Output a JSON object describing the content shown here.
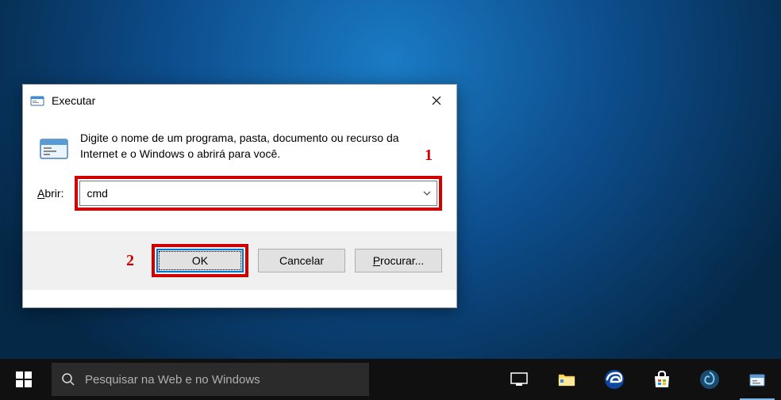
{
  "dialog": {
    "title": "Executar",
    "description": "Digite o nome de um programa, pasta, documento ou recurso da Internet e o Windows o abrirá para você.",
    "open_label_prefix": "A",
    "open_label_suffix": "brir:",
    "open_value": "cmd",
    "buttons": {
      "ok": "OK",
      "cancel": "Cancelar",
      "browse_prefix": "P",
      "browse_suffix": "rocurar..."
    }
  },
  "annotations": {
    "step1": "1",
    "step2": "2"
  },
  "taskbar": {
    "search_placeholder": "Pesquisar na Web e no Windows"
  }
}
